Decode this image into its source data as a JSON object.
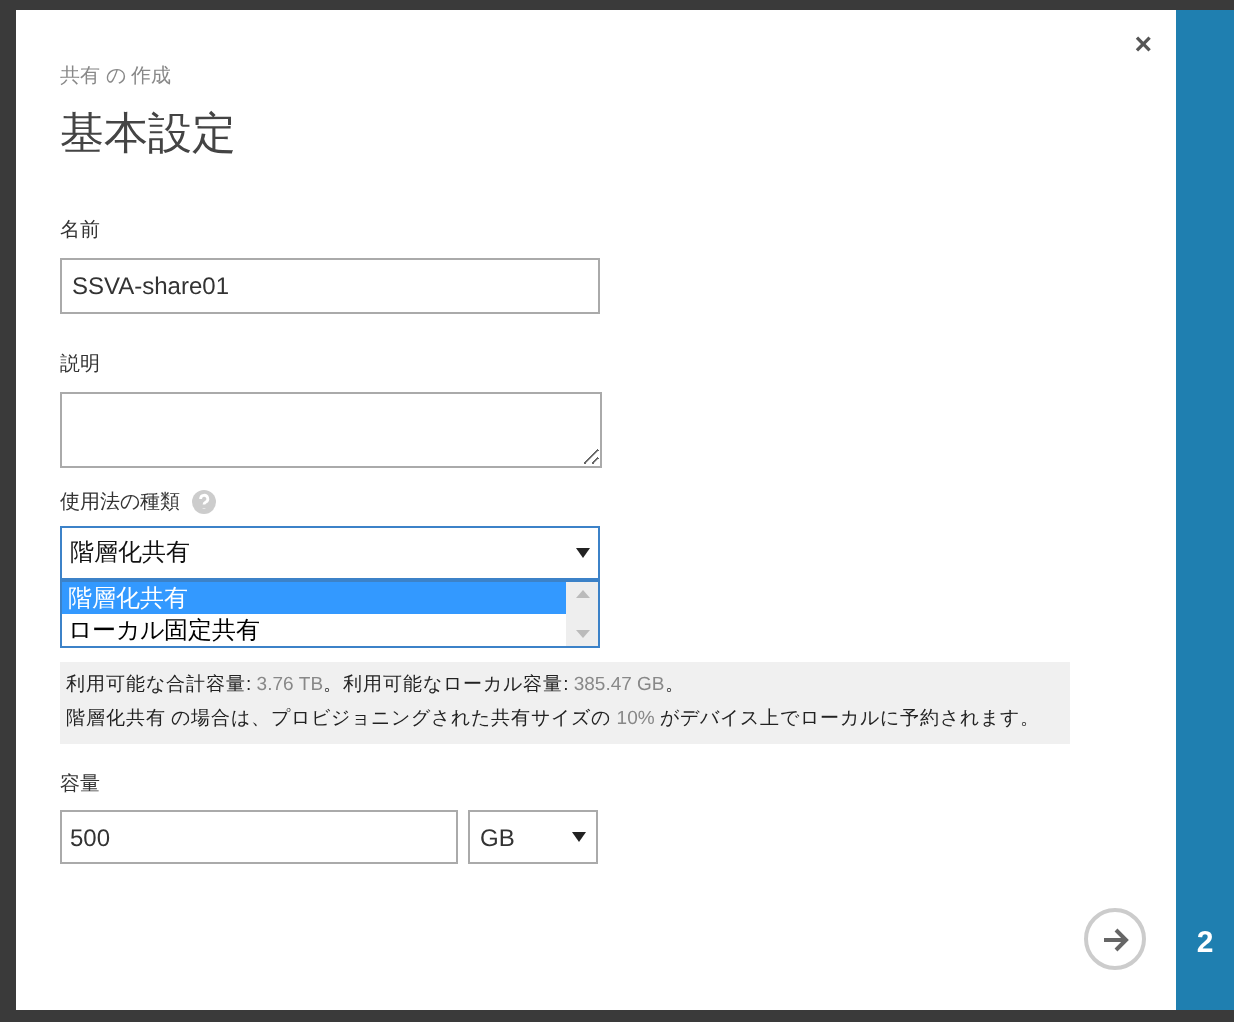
{
  "dialog": {
    "subtitle": "共有 の 作成",
    "title": "基本設定",
    "close": "×"
  },
  "name_field": {
    "label": "名前",
    "value": "SSVA-share01"
  },
  "description_field": {
    "label": "説明"
  },
  "usage_type": {
    "label": "使用法の種類",
    "value": "階層化共有",
    "expanded": true,
    "options": [
      {
        "label": "階層化共有",
        "selected": true
      },
      {
        "label": "ローカル固定共有",
        "selected": false
      }
    ]
  },
  "info": {
    "lines": [
      [
        {
          "kind": "text",
          "text": "利用可能な合計容量: "
        },
        {
          "kind": "value",
          "text": "3.76 TB"
        },
        {
          "kind": "text",
          "text": "。利用可能なローカル容量: "
        },
        {
          "kind": "value",
          "text": "385.47 GB"
        },
        {
          "kind": "text",
          "text": "。"
        }
      ],
      [
        {
          "kind": "text",
          "text": "階層化共有 の場合は、プロビジョニングされた共有サイズの "
        },
        {
          "kind": "value",
          "text": "10%"
        },
        {
          "kind": "text",
          "text": " がデバイス上でローカルに予約されます。"
        }
      ]
    ]
  },
  "capacity": {
    "label": "容量",
    "value": "500",
    "unit": "GB"
  },
  "step": {
    "number": "2"
  }
}
